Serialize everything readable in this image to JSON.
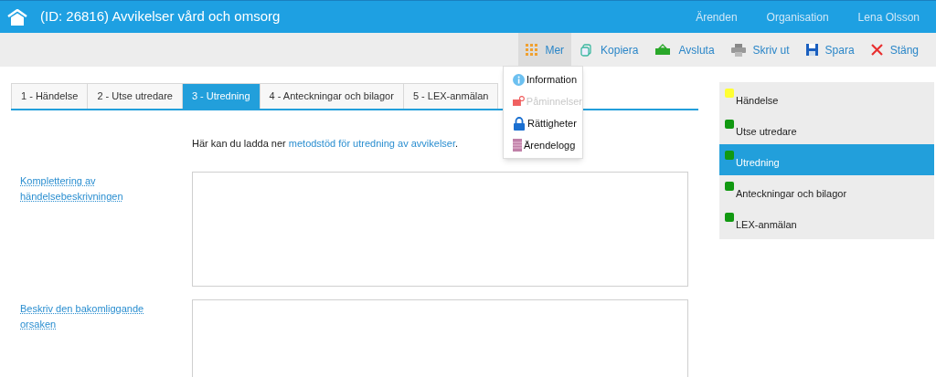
{
  "header": {
    "title": "(ID: 26816) Avvikelser vård och omsorg",
    "nav": [
      "Ärenden",
      "Organisation",
      "Lena Olsson"
    ]
  },
  "toolbar": [
    {
      "label": "Mer",
      "kind": "grid",
      "selected": true
    },
    {
      "label": "Kopiera",
      "kind": "copy",
      "selected": false
    },
    {
      "label": "Avsluta",
      "kind": "register",
      "selected": false
    },
    {
      "label": "Skriv ut",
      "kind": "printer",
      "selected": false
    },
    {
      "label": "Spara",
      "kind": "save",
      "selected": false
    },
    {
      "label": "Stäng",
      "kind": "close",
      "selected": false
    }
  ],
  "menu": [
    {
      "label": "Information",
      "kind": "info",
      "disabled": false
    },
    {
      "label": "Påminnelser",
      "kind": "reminder",
      "disabled": true
    },
    {
      "label": "Rättigheter",
      "kind": "lock",
      "disabled": false
    },
    {
      "label": "Ärendelogg",
      "kind": "log",
      "disabled": false
    }
  ],
  "tabs": [
    {
      "label": "1 - Händelse",
      "selected": false
    },
    {
      "label": "2 - Utse utredare",
      "selected": false
    },
    {
      "label": "3 - Utredning",
      "selected": true
    },
    {
      "label": "4 - Anteckningar och bilagor",
      "selected": false
    },
    {
      "label": "5 - LEX-anmälan",
      "selected": false
    }
  ],
  "intro": {
    "text": "Här kan du ladda ner",
    "link": "metodstöd för utredning av avvikelser",
    "after": "."
  },
  "fields": [
    {
      "label": "Komplettering av händelsebeskrivningen"
    },
    {
      "label": "Beskriv den bakomliggande orsaken"
    }
  ],
  "steps": [
    {
      "label": "Händelse",
      "color": "#ffff33",
      "selected": false
    },
    {
      "label": "Utse utredare",
      "color": "#119911",
      "selected": false
    },
    {
      "label": "Utredning",
      "color": "#119911",
      "selected": true
    },
    {
      "label": "Anteckningar och bilagor",
      "color": "#119911",
      "selected": false
    },
    {
      "label": "LEX-anmälan",
      "color": "#119911",
      "selected": false
    }
  ]
}
